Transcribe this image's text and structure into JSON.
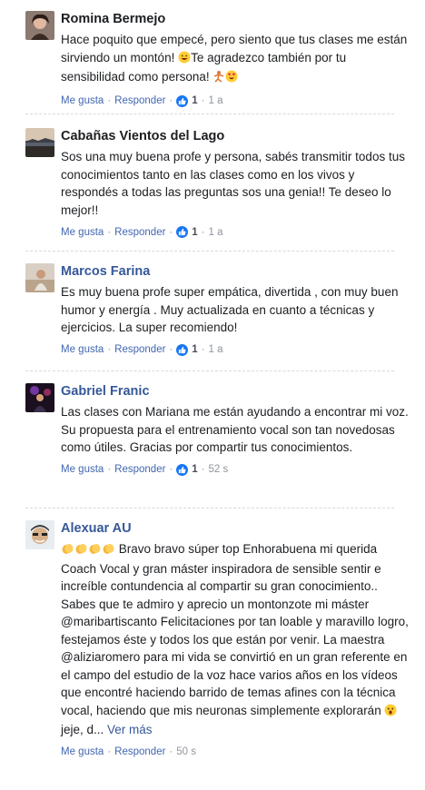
{
  "comments": [
    {
      "name": "Romina Bermejo",
      "text_a": "Hace poquito que empecé, pero siento que tus clases me están sirviendo un montón! ",
      "text_b": "Te agradezco también por tu sensibilidad como persona! ",
      "like": "Me gusta",
      "reply": "Responder",
      "reactions": "1",
      "time": "1 a"
    },
    {
      "name": "Cabañas Vientos del Lago",
      "text": "Sos una muy buena profe y persona, sabés transmitir todos tus conocimientos tanto en las clases como en los vivos y respondés a todas las preguntas sos una genia!! Te deseo lo mejor!!",
      "like": "Me gusta",
      "reply": "Responder",
      "reactions": "1",
      "time": "1 a"
    },
    {
      "name": "Marcos Farina",
      "text": "Es muy buena profe super empática, divertida , con muy buen humor y energía . Muy actualizada en cuanto a técnicas y ejercicios. La super recomiendo!",
      "like": "Me gusta",
      "reply": "Responder",
      "reactions": "1",
      "time": "1 a"
    },
    {
      "name": "Gabriel Franic",
      "text": "Las clases con Mariana me están ayudando a encontrar mi voz. Su propuesta para el entrenamiento vocal son tan novedosas como útiles. Gracias por compartir tus conocimientos.",
      "like": "Me gusta",
      "reply": "Responder",
      "reactions": "1",
      "time": "52 s"
    },
    {
      "name": "Alexuar AU",
      "text_a": " Bravo bravo súper top Enhorabuena mi querida Coach Vocal y gran máster inspiradora de sensible sentir e increíble contundencia al compartir su gran conocimiento.. Sabes que te admiro y aprecio un montonzote mi máster @maribartiscanto Felicitaciones por tan loable y maravillo logro, festejamos éste y todos los que están por venir. La maestra @aliziaromero para mi vida se convirtió en un gran referente en el campo del estudio de la voz hace varios años en los vídeos que encontré haciendo barrido de temas afines con la técnica vocal, haciendo que mis neuronas simplemente explorarán ",
      "text_b": " jeje, d... ",
      "see_more": "Ver más",
      "like": "Me gusta",
      "reply": "Responder",
      "time": "50 s"
    }
  ],
  "icons": {
    "like_badge": "thumbs-up-icon",
    "emoji_smile": "grinning-face-icon",
    "emoji_heart_eyes": "heart-eyes-face-icon",
    "emoji_clap": "clapping-hands-icon",
    "emoji_shocked": "astonished-face-icon"
  },
  "colors": {
    "link": "#365899",
    "action": "#4267b2",
    "meta": "#90949c",
    "like_blue": "#1877f2"
  }
}
